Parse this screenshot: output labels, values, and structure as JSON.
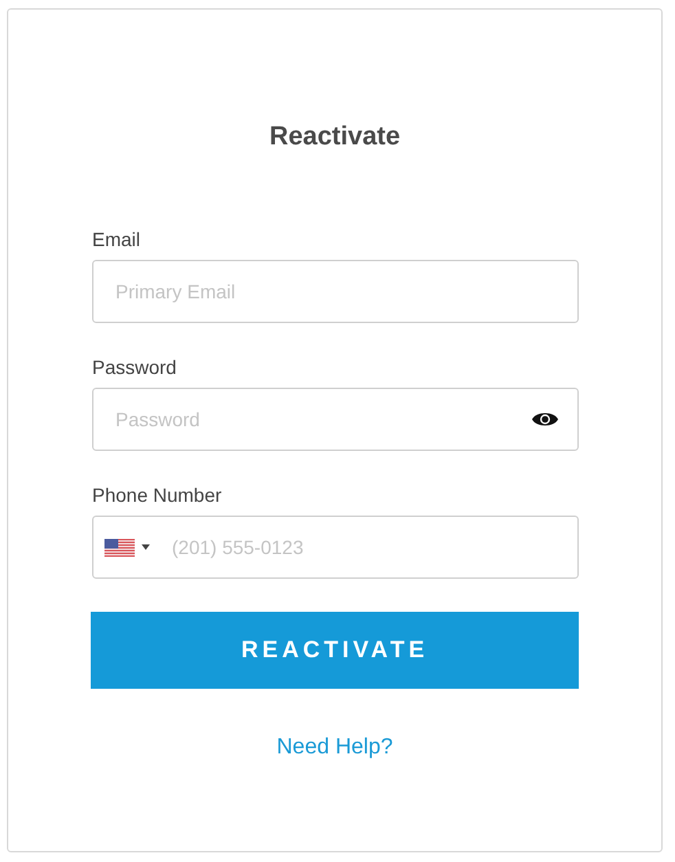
{
  "title": "Reactivate",
  "fields": [
    {
      "kind": "email",
      "label": "Email",
      "placeholder": "Primary Email"
    },
    {
      "kind": "password",
      "label": "Password",
      "placeholder": "Password"
    },
    {
      "kind": "phone",
      "label": "Phone Number",
      "placeholder": "(201) 555-0123"
    }
  ],
  "submit": "REACTIVATE",
  "help_link": "Need Help?"
}
